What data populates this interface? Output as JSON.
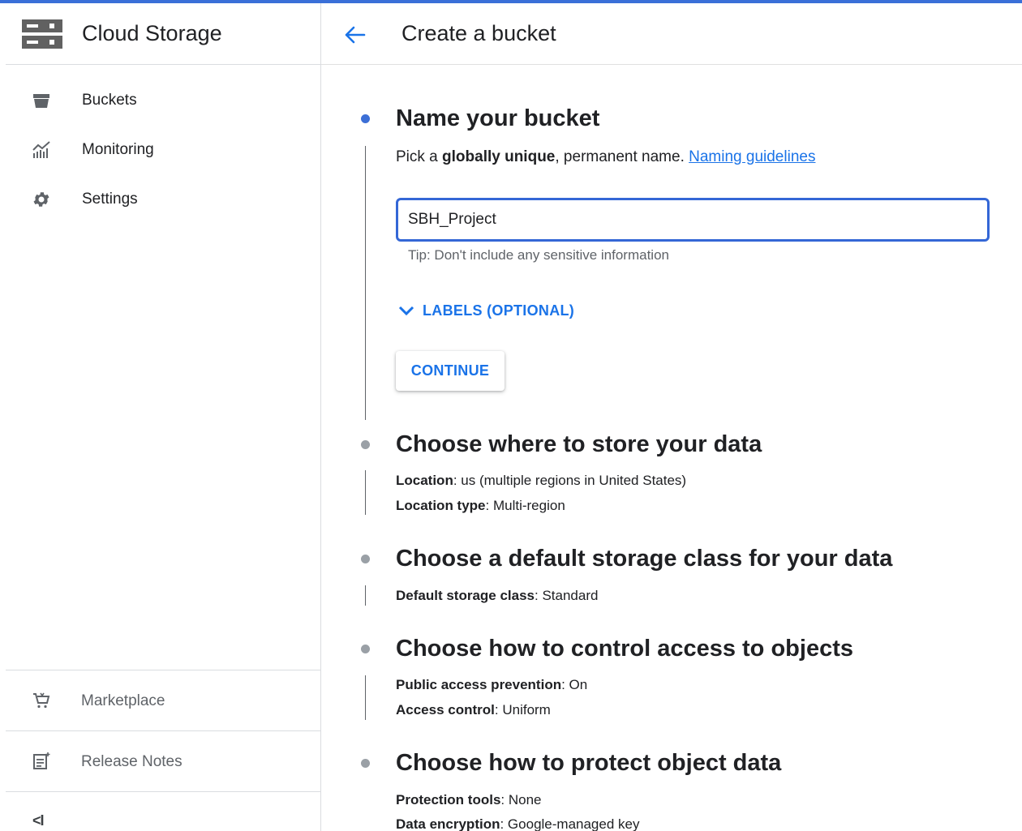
{
  "sidebar": {
    "product_title": "Cloud Storage",
    "nav": [
      {
        "label": "Buckets",
        "icon": "bucket-icon"
      },
      {
        "label": "Monitoring",
        "icon": "monitoring-icon"
      },
      {
        "label": "Settings",
        "icon": "gear-icon"
      }
    ],
    "footer": [
      {
        "label": "Marketplace",
        "icon": "marketplace-cart-icon"
      },
      {
        "label": "Release Notes",
        "icon": "release-notes-icon"
      }
    ],
    "collapse_label": "<I"
  },
  "header": {
    "title": "Create a bucket"
  },
  "steps": {
    "name": {
      "title": "Name your bucket",
      "desc_pre": "Pick a ",
      "desc_bold": "globally unique",
      "desc_post": ", permanent name. ",
      "desc_link": "Naming guidelines",
      "input_value": "SBH_Project",
      "tip": "Tip: Don't include any sensitive information",
      "labels_toggle": "LABELS (OPTIONAL)",
      "continue_label": "CONTINUE"
    },
    "location": {
      "title": "Choose where to store your data",
      "rows": [
        {
          "key": "Location",
          "value": ": us (multiple regions in United States)"
        },
        {
          "key": "Location type",
          "value": ": Multi-region"
        }
      ]
    },
    "storage_class": {
      "title": "Choose a default storage class for your data",
      "rows": [
        {
          "key": "Default storage class",
          "value": ": Standard"
        }
      ]
    },
    "access": {
      "title": "Choose how to control access to objects",
      "rows": [
        {
          "key": "Public access prevention",
          "value": ": On"
        },
        {
          "key": "Access control",
          "value": ": Uniform"
        }
      ]
    },
    "protection": {
      "title": "Choose how to protect object data",
      "rows": [
        {
          "key": "Protection tools",
          "value": ": None"
        },
        {
          "key": "Data encryption",
          "value": ": Google-managed key"
        }
      ]
    }
  },
  "colors": {
    "accent": "#1a73e8",
    "input_border": "#3467d6",
    "active_dot": "#3c6fd6",
    "inactive_dot": "#9aa0a6"
  }
}
